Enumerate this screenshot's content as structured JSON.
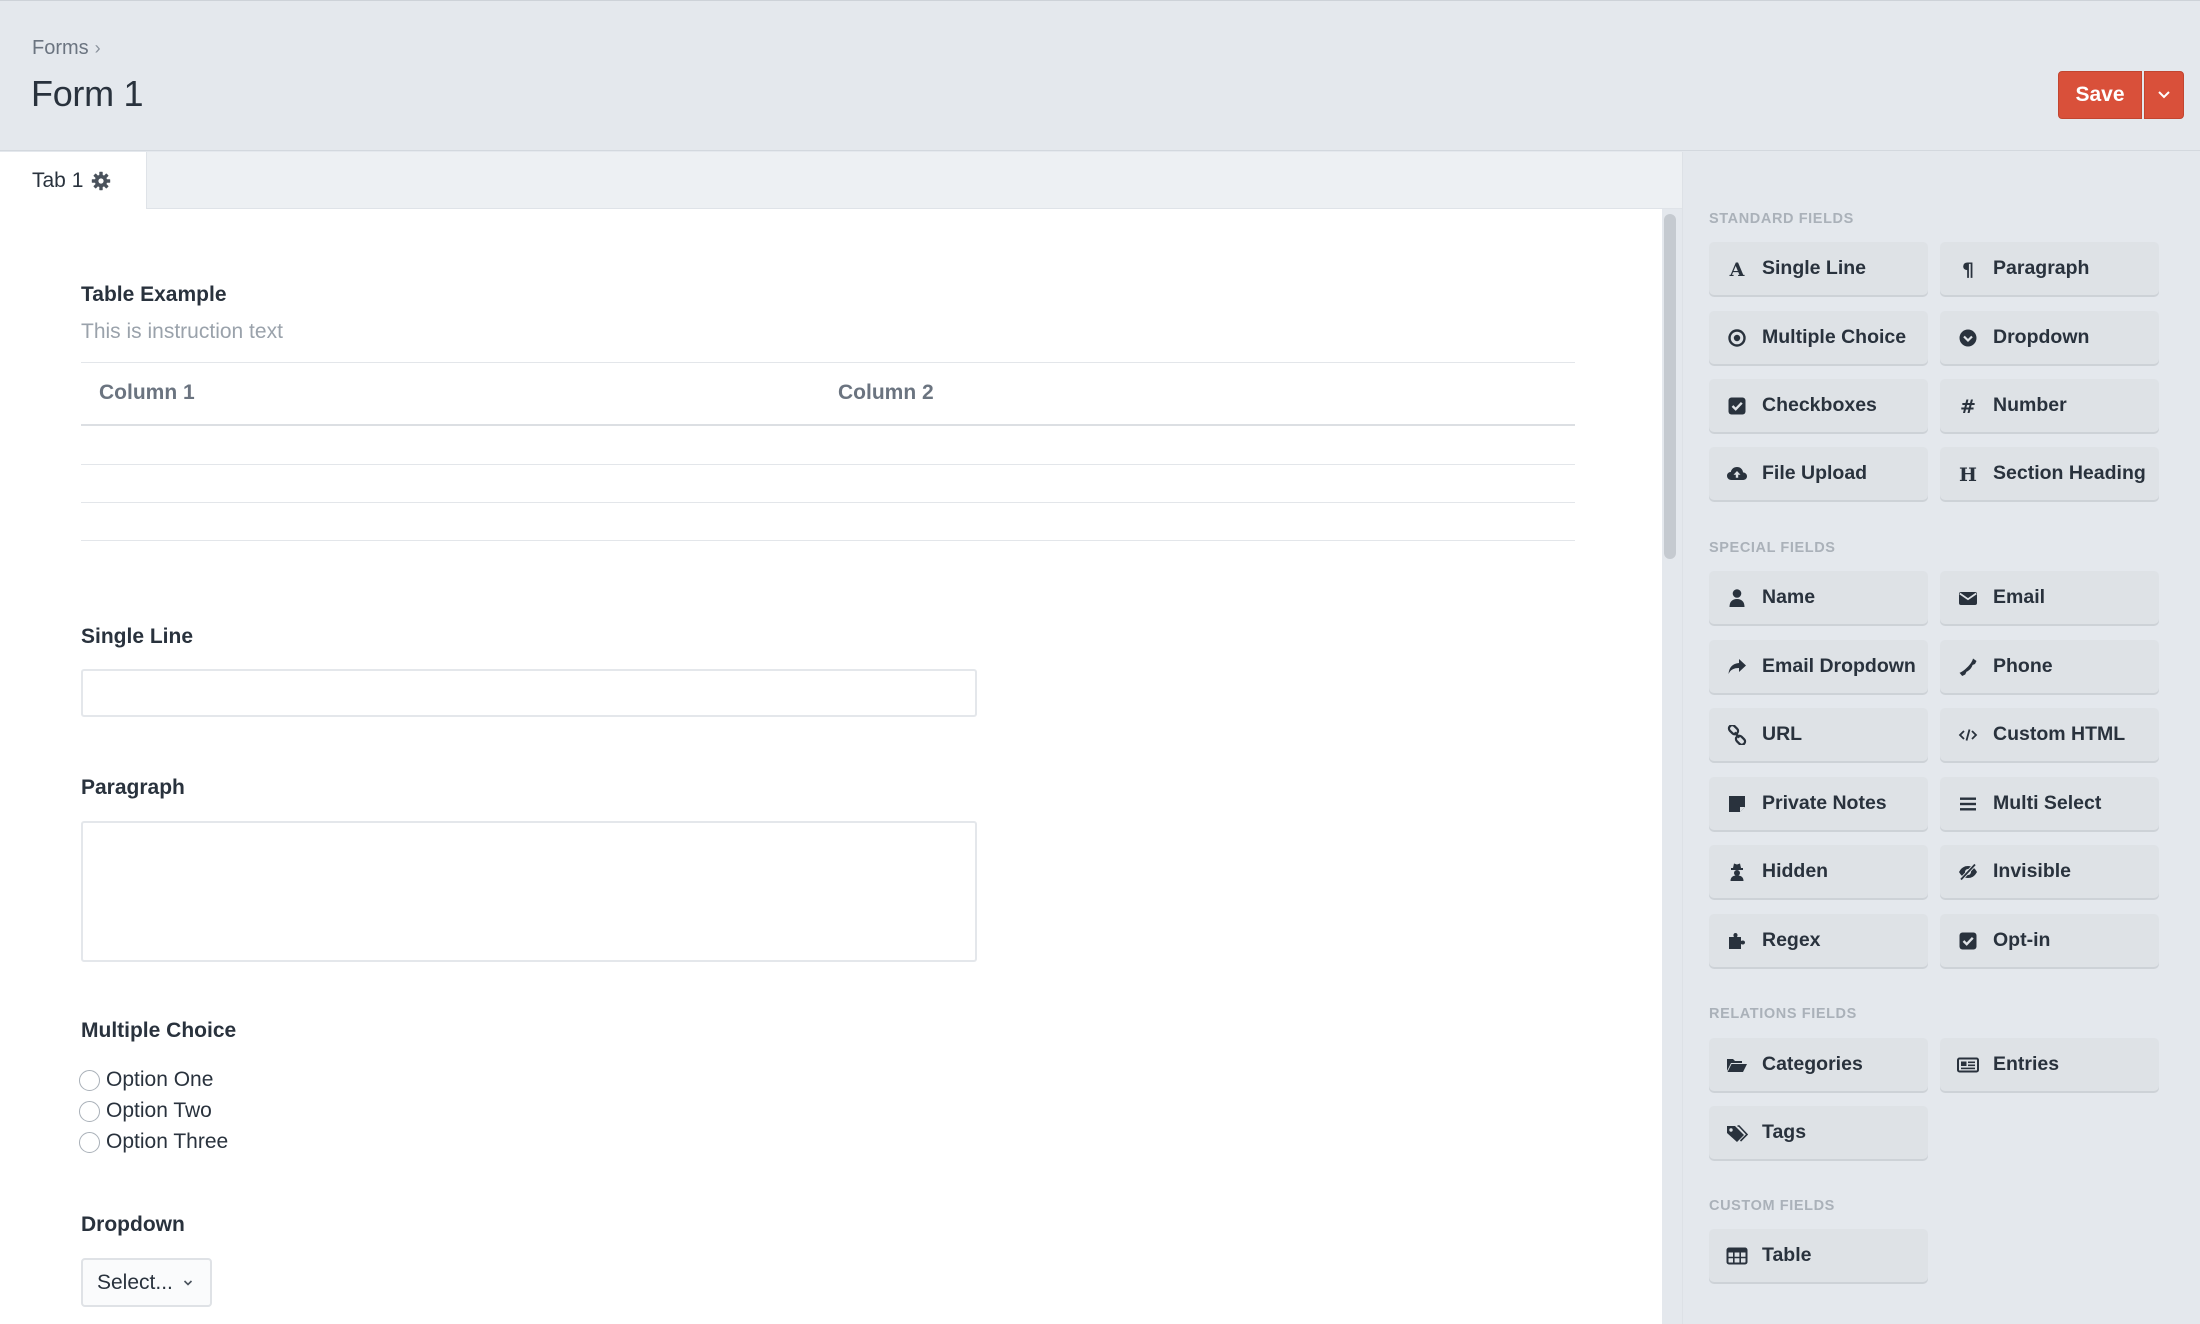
{
  "header": {
    "breadcrumb": "Forms",
    "title": "Form 1",
    "save_label": "Save"
  },
  "tabs": [
    {
      "label": "Tab 1"
    }
  ],
  "form": {
    "table_field": {
      "label": "Table Example",
      "instructions": "This is instruction text",
      "columns": [
        "Column 1",
        "Column 2"
      ]
    },
    "single_line_label": "Single Line",
    "paragraph_label": "Paragraph",
    "multiple_choice": {
      "label": "Multiple Choice",
      "options": [
        "Option One",
        "Option Two",
        "Option Three"
      ]
    },
    "dropdown": {
      "label": "Dropdown",
      "selected": "Select..."
    }
  },
  "sidebar": {
    "standard": {
      "heading": "STANDARD FIELDS",
      "items": [
        {
          "label": "Single Line",
          "icon": "font-icon"
        },
        {
          "label": "Paragraph",
          "icon": "paragraph-icon"
        },
        {
          "label": "Multiple Choice",
          "icon": "radio-icon"
        },
        {
          "label": "Dropdown",
          "icon": "dropdown-icon"
        },
        {
          "label": "Checkboxes",
          "icon": "checkbox-icon"
        },
        {
          "label": "Number",
          "icon": "hash-icon"
        },
        {
          "label": "File Upload",
          "icon": "cloud-upload-icon"
        },
        {
          "label": "Section Heading",
          "icon": "heading-icon"
        }
      ]
    },
    "special": {
      "heading": "SPECIAL FIELDS",
      "items": [
        {
          "label": "Name",
          "icon": "user-icon"
        },
        {
          "label": "Email",
          "icon": "envelope-icon"
        },
        {
          "label": "Email Dropdown",
          "icon": "share-icon"
        },
        {
          "label": "Phone",
          "icon": "phone-icon"
        },
        {
          "label": "URL",
          "icon": "link-icon"
        },
        {
          "label": "Custom HTML",
          "icon": "code-icon"
        },
        {
          "label": "Private Notes",
          "icon": "note-icon"
        },
        {
          "label": "Multi Select",
          "icon": "list-icon"
        },
        {
          "label": "Hidden",
          "icon": "user-secret-icon"
        },
        {
          "label": "Invisible",
          "icon": "eye-slash-icon"
        },
        {
          "label": "Regex",
          "icon": "puzzle-icon"
        },
        {
          "label": "Opt-in",
          "icon": "checkbox-icon"
        }
      ]
    },
    "relations": {
      "heading": "RELATIONS FIELDS",
      "items": [
        {
          "label": "Categories",
          "icon": "folder-open-icon"
        },
        {
          "label": "Entries",
          "icon": "newspaper-icon"
        },
        {
          "label": "Tags",
          "icon": "tags-icon"
        }
      ]
    },
    "custom": {
      "heading": "CUSTOM FIELDS",
      "items": [
        {
          "label": "Table",
          "icon": "table-icon"
        }
      ]
    }
  }
}
